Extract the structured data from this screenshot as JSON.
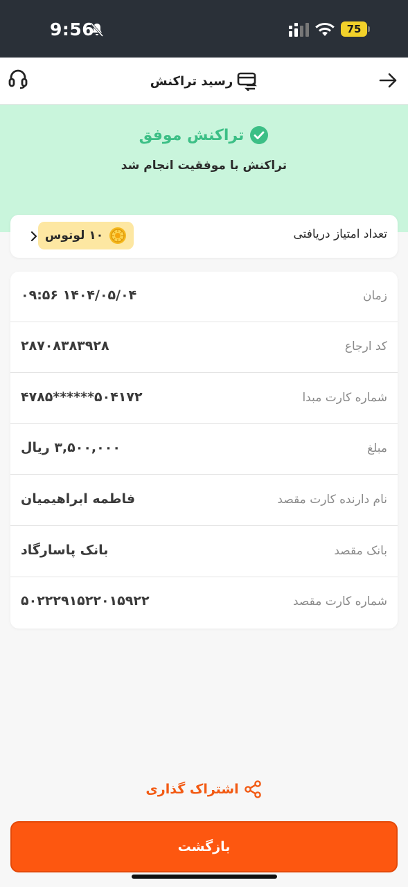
{
  "status_bar": {
    "time": "9:56",
    "battery": "75",
    "icons": [
      "bell-off-icon",
      "cellular-icon",
      "wifi-icon",
      "battery-icon"
    ]
  },
  "header": {
    "title": "رسید تراکنش",
    "icons": [
      "card-swap-icon",
      "back-arrow-icon",
      "headset-icon"
    ]
  },
  "banner": {
    "title": "تراکنش موفق",
    "subtitle": "تراکنش با موفقیت انجام شد"
  },
  "points": {
    "label": "تعداد امتیاز دریافتی",
    "value": "۱۰ لوتوس"
  },
  "details": [
    {
      "label": "زمان",
      "value": "۱۴۰۴/۰۵/۰۴ ۰۹:۵۶"
    },
    {
      "label": "کد ارجاع",
      "value": "۲۸۷۰۸۳۸۳۹۲۸"
    },
    {
      "label": "شماره کارت مبدا",
      "value": "۵۰۴۱۷۲******۴۷۸۵"
    },
    {
      "label": "مبلغ",
      "value": "۳,۵۰۰,۰۰۰ ریال"
    },
    {
      "label": "نام دارنده کارت مقصد",
      "value": "فاطمه ابراهیمیان"
    },
    {
      "label": "بانک مقصد",
      "value": "بانک پاسارگاد"
    },
    {
      "label": "شماره کارت مقصد",
      "value": "۵۰۲۲۲۹۱۵۲۲۰۱۵۹۲۲"
    }
  ],
  "actions": {
    "share_label": "اشتراک گذاری",
    "back_label": "بازگشت"
  },
  "colors": {
    "accent": "#fd5710",
    "success": "#3cbf86",
    "banner_bg": "#c9f5dc",
    "badge_bg": "#fde7a2"
  }
}
